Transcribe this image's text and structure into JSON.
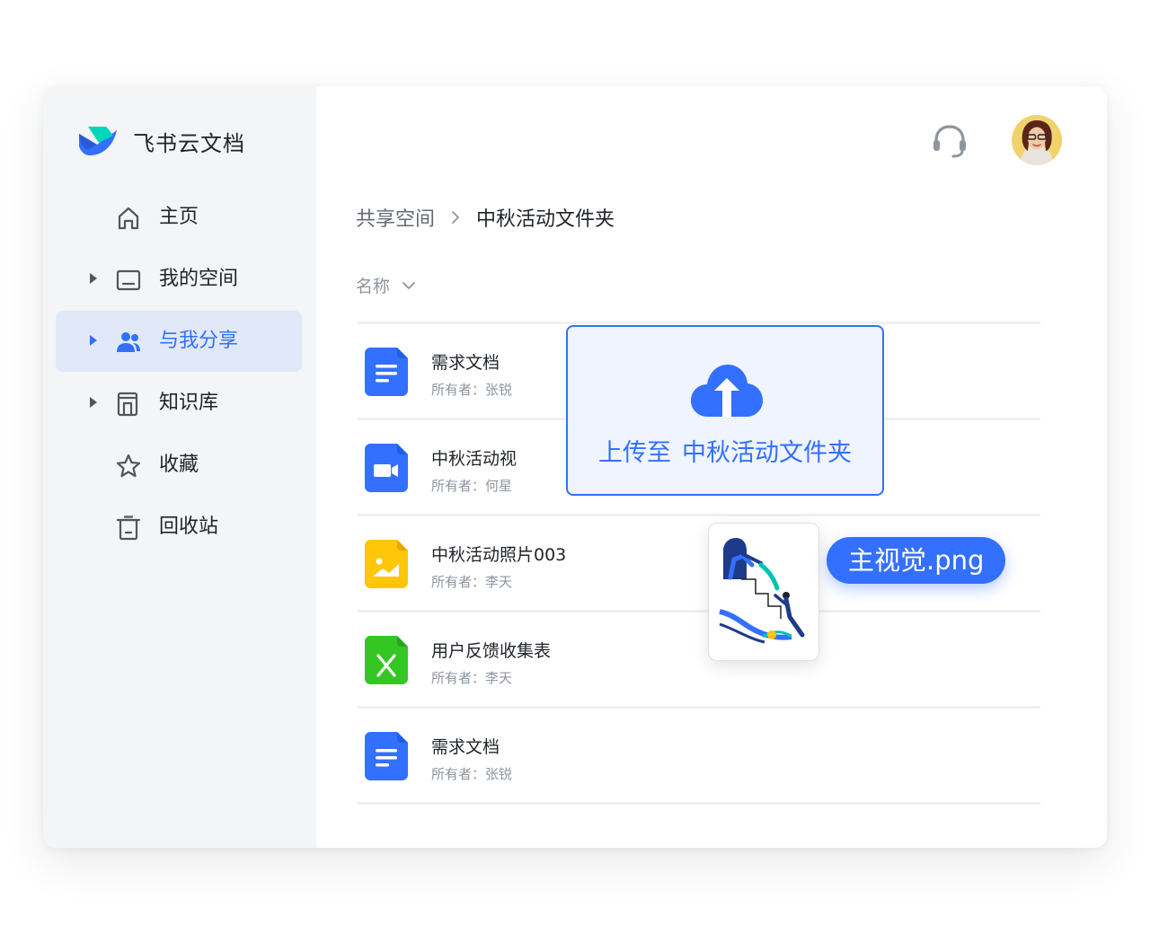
{
  "app": {
    "title": "飞书云文档"
  },
  "sidebar": {
    "items": [
      {
        "label": "主页",
        "icon": "home-icon",
        "expandable": false,
        "active": false
      },
      {
        "label": "我的空间",
        "icon": "folder-icon",
        "expandable": true,
        "active": false
      },
      {
        "label": "与我分享",
        "icon": "users-icon",
        "expandable": true,
        "active": true
      },
      {
        "label": "知识库",
        "icon": "library-icon",
        "expandable": true,
        "active": false
      },
      {
        "label": "收藏",
        "icon": "star-icon",
        "expandable": false,
        "active": false
      },
      {
        "label": "回收站",
        "icon": "trash-icon",
        "expandable": false,
        "active": false
      }
    ]
  },
  "header": {
    "headset_icon": "headset-icon",
    "avatar_icon": "avatar"
  },
  "breadcrumb": {
    "parent": "共享空间",
    "current": "中秋活动文件夹"
  },
  "sort": {
    "label": "名称"
  },
  "files": [
    {
      "name": "需求文档",
      "owner": "所有者：张锐",
      "type": "doc"
    },
    {
      "name": "中秋活动视",
      "owner": "所有者：何星",
      "type": "video"
    },
    {
      "name": "中秋活动照片003",
      "owner": "所有者：李天",
      "type": "image"
    },
    {
      "name": "用户反馈收集表",
      "owner": "所有者：李天",
      "type": "sheet"
    },
    {
      "name": "需求文档",
      "owner": "所有者：张锐",
      "type": "doc"
    }
  ],
  "upload": {
    "prefix": "上传至",
    "target": "中秋活动文件夹"
  },
  "drag": {
    "filename": "主视觉.png"
  },
  "colors": {
    "accent": "#3370ff",
    "sidebar_bg": "#f4f5f7",
    "active_bg": "#e1e8f8",
    "doc_icon": "#3370ff",
    "image_icon": "#ffc60a",
    "sheet_icon": "#34c724"
  }
}
